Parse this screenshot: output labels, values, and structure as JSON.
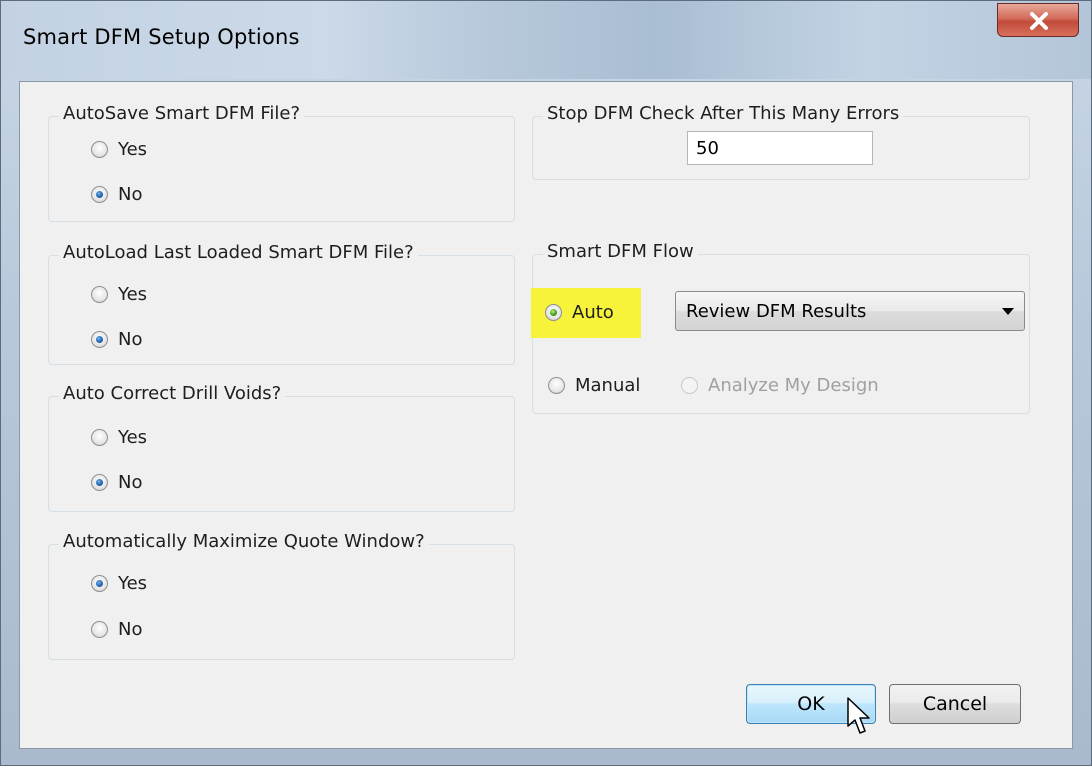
{
  "window": {
    "title": "Smart DFM Setup Options",
    "close_icon": "close-x-icon"
  },
  "groups": {
    "autosave": {
      "label": "AutoSave Smart DFM File?",
      "options": [
        {
          "label": "Yes",
          "checked": false
        },
        {
          "label": "No",
          "checked": true
        }
      ]
    },
    "autoload": {
      "label": "AutoLoad Last Loaded Smart DFM File?",
      "options": [
        {
          "label": "Yes",
          "checked": false
        },
        {
          "label": "No",
          "checked": true
        }
      ]
    },
    "drill_voids": {
      "label": "Auto Correct Drill Voids?",
      "options": [
        {
          "label": "Yes",
          "checked": false
        },
        {
          "label": "No",
          "checked": true
        }
      ]
    },
    "maximize_quote": {
      "label": "Automatically Maximize Quote Window?",
      "options": [
        {
          "label": "Yes",
          "checked": true
        },
        {
          "label": "No",
          "checked": false
        }
      ]
    },
    "stop_after": {
      "label": "Stop DFM Check After This Many Errors",
      "value": "50"
    },
    "flow": {
      "label": "Smart DFM Flow",
      "auto_label": "Auto",
      "auto_checked": true,
      "auto_select_value": "Review DFM Results",
      "manual_label": "Manual",
      "manual_checked": false,
      "manual_sub_label": "Analyze My Design",
      "manual_sub_enabled": false
    }
  },
  "buttons": {
    "ok": "OK",
    "cancel": "Cancel"
  },
  "colors": {
    "highlight": "#f7f33a"
  }
}
